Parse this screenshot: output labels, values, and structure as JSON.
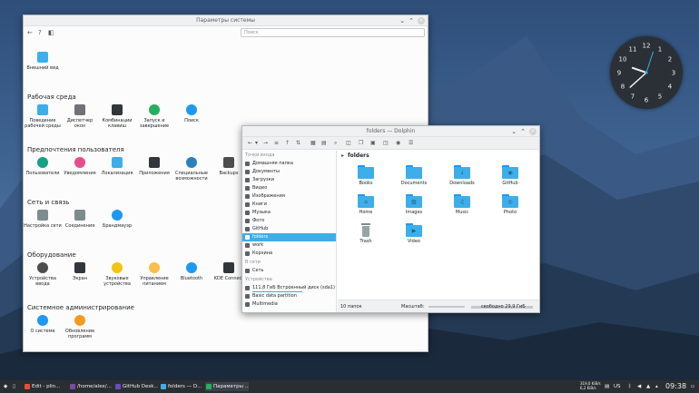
{
  "colors": {
    "accent": "#3daee9",
    "folder": "#3daee9",
    "taskbar": "#2a2e32"
  },
  "settings": {
    "title": "Параметры системы",
    "search_placeholder": "Поиск",
    "toolbar": {
      "back": "←",
      "help": "?",
      "sidebar_toggle": "◧"
    },
    "top_item": {
      "label": "Внешний вид",
      "icon": "appearance-icon"
    },
    "sections": [
      {
        "title": "Рабочая среда",
        "items": [
          {
            "label": "Поведение рабочей среды",
            "icon": "workspace-icon",
            "color": "#3daee9"
          },
          {
            "label": "Диспетчер окон",
            "icon": "window-manager-icon",
            "color": "#6e7378"
          },
          {
            "label": "Комбинации клавиш",
            "icon": "keyboard-icon",
            "color": "#31363b"
          },
          {
            "label": "Запуск и завершение",
            "icon": "startup-icon",
            "color": "#27ae60"
          },
          {
            "label": "Поиск",
            "icon": "search-icon",
            "color": "#1d99f3"
          }
        ]
      },
      {
        "title": "Предпочтения пользователя",
        "items": [
          {
            "label": "Пользователи",
            "icon": "users-icon",
            "color": "#16a085"
          },
          {
            "label": "Уведомления",
            "icon": "notifications-icon",
            "color": "#e74c8c"
          },
          {
            "label": "Локализация",
            "icon": "localization-icon",
            "color": "#3daee9"
          },
          {
            "label": "Приложения",
            "icon": "applications-icon",
            "color": "#31363b"
          },
          {
            "label": "Специальные возможности",
            "icon": "accessibility-icon",
            "color": "#2980b9"
          },
          {
            "label": "Backups",
            "icon": "backups-icon",
            "color": "#4d4d4d"
          }
        ]
      },
      {
        "title": "Сеть и связь",
        "items": [
          {
            "label": "Настройка сети",
            "icon": "network-icon",
            "color": "#7f8c8d"
          },
          {
            "label": "Соединения",
            "icon": "connections-icon",
            "color": "#7f8c8d"
          },
          {
            "label": "Брандмауэр",
            "icon": "firewall-icon",
            "color": "#1d99f3"
          }
        ]
      },
      {
        "title": "Оборудование",
        "items": [
          {
            "label": "Устройства ввода",
            "icon": "input-devices-icon",
            "color": "#4d4d4d"
          },
          {
            "label": "Экран",
            "icon": "display-icon",
            "color": "#31363b"
          },
          {
            "label": "Звуковые устройства",
            "icon": "audio-icon",
            "color": "#f1c40f"
          },
          {
            "label": "Управление питанием",
            "icon": "power-icon",
            "color": "#fdbc4b"
          },
          {
            "label": "Bluetooth",
            "icon": "bluetooth-icon",
            "color": "#1d99f3"
          },
          {
            "label": "KDE Connect",
            "icon": "kde-connect-icon",
            "color": "#31363b"
          }
        ]
      },
      {
        "title": "Системное администрирование",
        "items": [
          {
            "label": "О системе",
            "icon": "info-icon",
            "color": "#1d99f3"
          },
          {
            "label": "Обновление программ",
            "icon": "update-icon",
            "color": "#f39c1f"
          }
        ]
      }
    ]
  },
  "dolphin": {
    "title": "folders — Dolphin",
    "breadcrumb": "folders",
    "sidebar": {
      "places_header": "Точки входа",
      "places": [
        "Домашняя папка",
        "Документы",
        "Загрузки",
        "Видео",
        "Изображения",
        "Книги",
        "Музыка",
        "Фото",
        "GitHub",
        "folders",
        "work",
        "Корзина"
      ],
      "selected": "folders",
      "network_header": "В сети",
      "network": [
        "Сеть"
      ],
      "devices_header": "Устройства",
      "devices": [
        "111,8 ГиБ Встроенный диск (sda1)",
        "Basic data partition",
        "Multimedia"
      ]
    },
    "folders": [
      {
        "name": "Books",
        "glyph": ""
      },
      {
        "name": "Documents",
        "glyph": ""
      },
      {
        "name": "Downloads",
        "glyph": "↓"
      },
      {
        "name": "GitHub",
        "glyph": "◉"
      },
      {
        "name": "Home",
        "glyph": "⌂"
      },
      {
        "name": "Images",
        "glyph": "▨"
      },
      {
        "name": "Music",
        "glyph": "♫"
      },
      {
        "name": "Photo",
        "glyph": "◎"
      },
      {
        "name": "Trash",
        "glyph": ""
      },
      {
        "name": "Video",
        "glyph": "▶"
      }
    ],
    "status": {
      "count": "10 папок",
      "zoom_label": "Масштаб:",
      "free": "свободно 29,9 ГиБ"
    }
  },
  "taskbar": {
    "tasks": [
      {
        "label": "Edit - plin...",
        "color": "#e74c3c"
      },
      {
        "label": "/home/alex/...",
        "color": "#7a4ba0"
      },
      {
        "label": "GitHub Desk...",
        "color": "#6a4bc1"
      },
      {
        "label": "folders — D...",
        "color": "#3daee9"
      },
      {
        "label": "Параметры ...",
        "color": "#27ae60"
      }
    ],
    "net_up": "319,0 KiB/s",
    "net_down": "6,2 KiB/s",
    "layout": "US",
    "time": "09:38"
  },
  "clock": {
    "numerals": [
      "12",
      "3",
      "6",
      "9",
      "1",
      "2",
      "4",
      "5",
      "7",
      "8",
      "10",
      "11"
    ]
  }
}
